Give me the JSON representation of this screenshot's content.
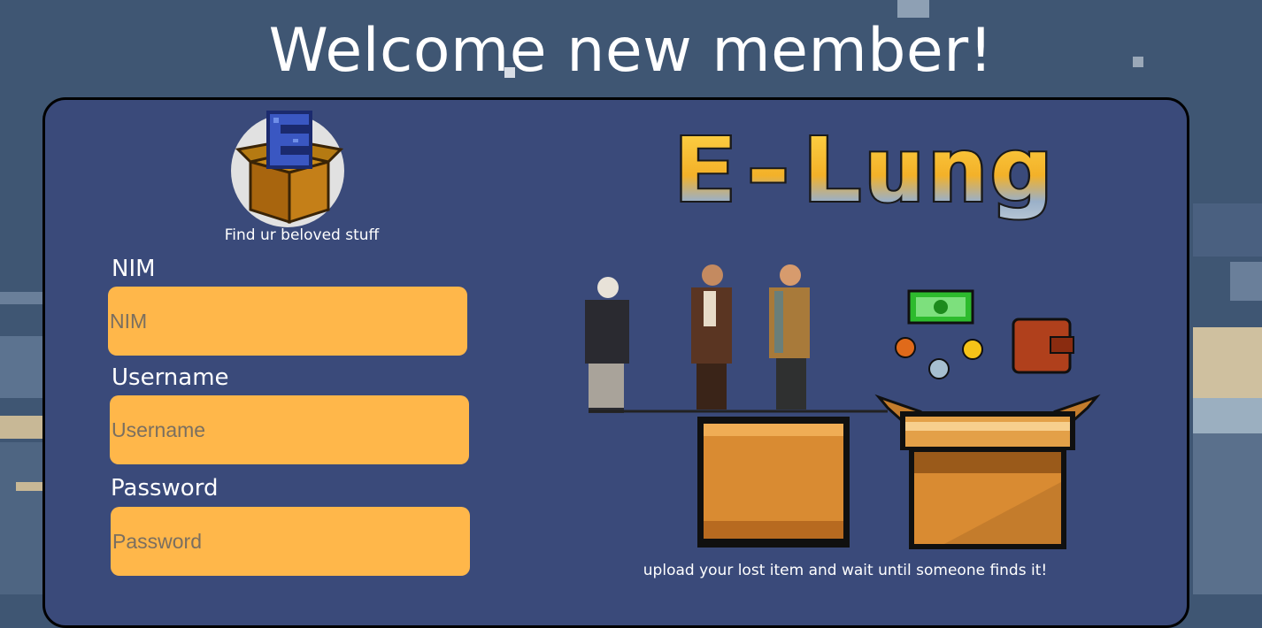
{
  "page": {
    "title": "Welcome new member!",
    "colors": {
      "background": "#3f5673",
      "card": "#3a4a7a",
      "field": "#ffb74a",
      "text": "#ffffff"
    }
  },
  "logo": {
    "icon": "e-box-logo-icon",
    "tagline": "Find ur beloved stuff"
  },
  "form": {
    "nim": {
      "label": "NIM",
      "placeholder": "NIM",
      "value": ""
    },
    "username": {
      "label": "Username",
      "placeholder": "Username",
      "value": ""
    },
    "password": {
      "label": "Password",
      "placeholder": "Password",
      "value": ""
    }
  },
  "brand": {
    "wordmark": "E-Lung"
  },
  "illustration": {
    "icons": [
      "people-icon",
      "cash-icon",
      "coin-icon",
      "wallet-icon",
      "closed-box-icon",
      "open-box-icon"
    ],
    "caption": "upload your lost item and wait until someone finds it!"
  }
}
